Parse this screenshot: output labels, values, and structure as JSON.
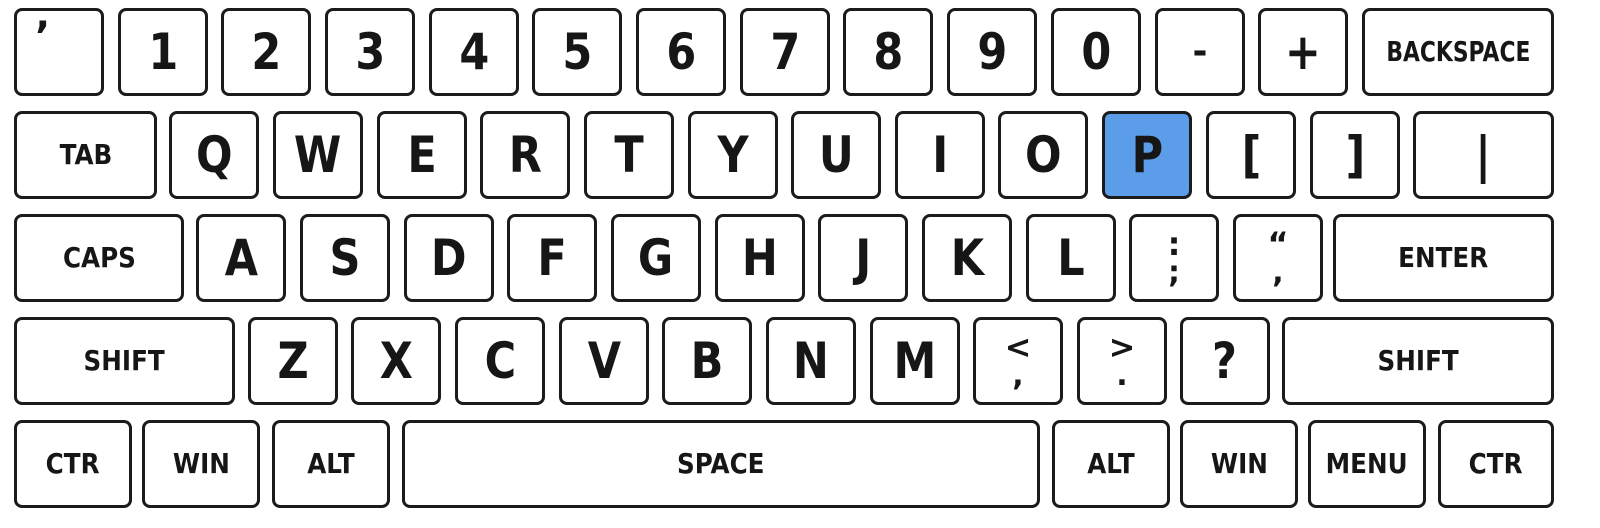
{
  "keyboard": {
    "accent_color": "#5b9de9",
    "highlighted_key": "P",
    "rows": [
      [
        {
          "label": "’",
          "style": "top-left"
        },
        {
          "label": "1",
          "style": "big"
        },
        {
          "label": "2",
          "style": "big"
        },
        {
          "label": "3",
          "style": "big"
        },
        {
          "label": "4",
          "style": "big"
        },
        {
          "label": "5",
          "style": "big"
        },
        {
          "label": "6",
          "style": "big"
        },
        {
          "label": "7",
          "style": "big"
        },
        {
          "label": "8",
          "style": "big"
        },
        {
          "label": "9",
          "style": "big"
        },
        {
          "label": "0",
          "style": "big"
        },
        {
          "label": "-",
          "style": "med"
        },
        {
          "label": "+",
          "style": "big"
        },
        {
          "label": "BACKSPACE",
          "style": "word tight"
        }
      ],
      [
        {
          "label": "TAB",
          "style": "word"
        },
        {
          "label": "Q",
          "style": "big"
        },
        {
          "label": "W",
          "style": "big"
        },
        {
          "label": "E",
          "style": "big"
        },
        {
          "label": "R",
          "style": "big"
        },
        {
          "label": "T",
          "style": "big"
        },
        {
          "label": "Y",
          "style": "big"
        },
        {
          "label": "U",
          "style": "big"
        },
        {
          "label": "I",
          "style": "big"
        },
        {
          "label": "O",
          "style": "big"
        },
        {
          "label": "P",
          "style": "big",
          "active": true
        },
        {
          "label": "[",
          "style": "big"
        },
        {
          "label": "]",
          "style": "big"
        },
        {
          "label": "|",
          "style": "big"
        }
      ],
      [
        {
          "label": "CAPS",
          "style": "word"
        },
        {
          "label": "A",
          "style": "big"
        },
        {
          "label": "S",
          "style": "big"
        },
        {
          "label": "D",
          "style": "big"
        },
        {
          "label": "F",
          "style": "big"
        },
        {
          "label": "G",
          "style": "big"
        },
        {
          "label": "H",
          "style": "big"
        },
        {
          "label": "J",
          "style": "big"
        },
        {
          "label": "K",
          "style": "big"
        },
        {
          "label": "L",
          "style": "big"
        },
        {
          "label": ":",
          "lower": ";",
          "style": "dual"
        },
        {
          "label": "“",
          "lower": ",",
          "style": "dual"
        },
        {
          "label": "ENTER",
          "style": "word"
        }
      ],
      [
        {
          "label": "SHIFT",
          "style": "word"
        },
        {
          "label": "Z",
          "style": "big"
        },
        {
          "label": "X",
          "style": "big"
        },
        {
          "label": "C",
          "style": "big"
        },
        {
          "label": "V",
          "style": "big"
        },
        {
          "label": "B",
          "style": "big"
        },
        {
          "label": "N",
          "style": "big"
        },
        {
          "label": "M",
          "style": "big"
        },
        {
          "label": "<",
          "lower": ",",
          "style": "dual"
        },
        {
          "label": ">",
          "lower": ".",
          "style": "dual"
        },
        {
          "label": "?",
          "style": "big"
        },
        {
          "label": "SHIFT",
          "style": "word"
        }
      ],
      [
        {
          "label": "CTR",
          "style": "word"
        },
        {
          "label": "WIN",
          "style": "word"
        },
        {
          "label": "ALT",
          "style": "word"
        },
        {
          "label": "SPACE",
          "style": "word"
        },
        {
          "label": "ALT",
          "style": "word"
        },
        {
          "label": "WIN",
          "style": "word"
        },
        {
          "label": "MENU",
          "style": "word"
        },
        {
          "label": "CTR",
          "style": "word"
        }
      ]
    ]
  }
}
